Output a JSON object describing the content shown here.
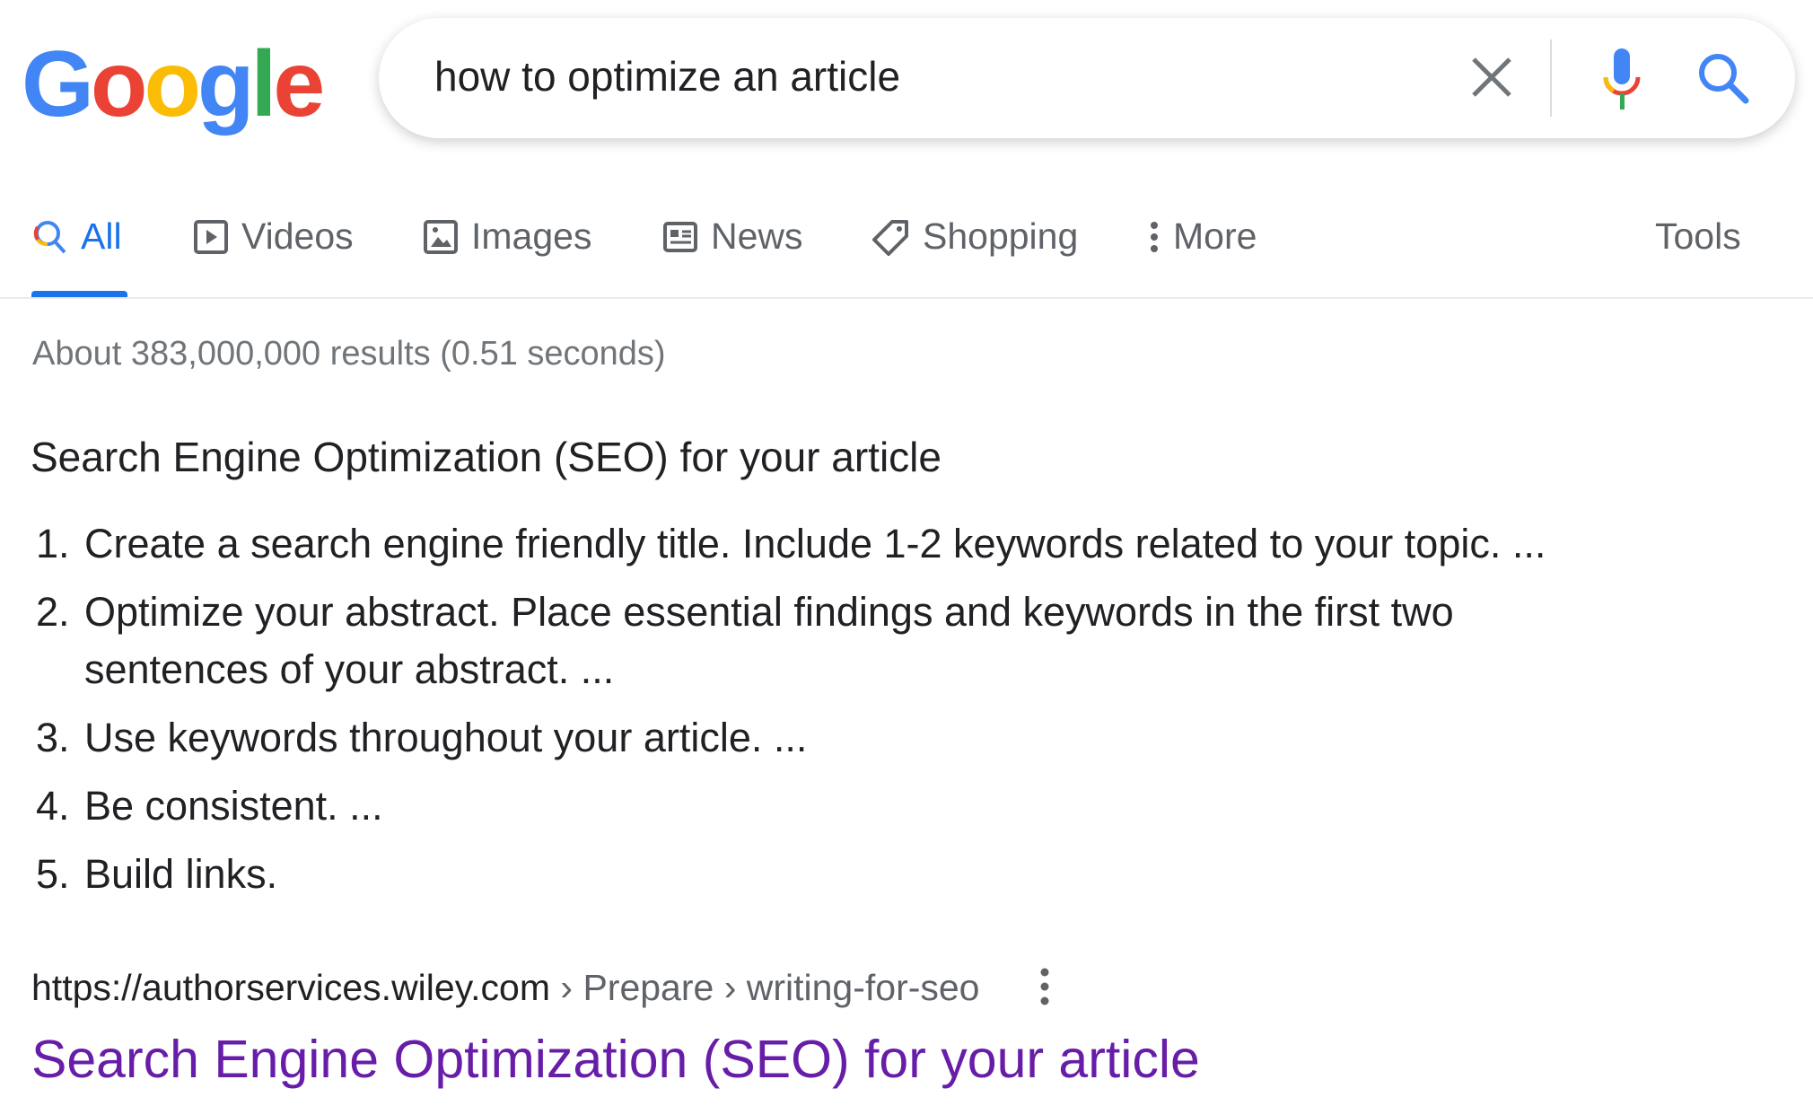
{
  "logo": {
    "text": "Google",
    "letters": [
      "G",
      "o",
      "o",
      "g",
      "l",
      "e"
    ],
    "colors": [
      "#4285f4",
      "#ea4335",
      "#fbbc05",
      "#4285f4",
      "#34a853",
      "#ea4335"
    ]
  },
  "search": {
    "query": "how to optimize an article",
    "icons": [
      "close-icon",
      "microphone-icon",
      "search-icon"
    ]
  },
  "tabs": [
    {
      "label": "All",
      "icon": "search-icon",
      "active": true
    },
    {
      "label": "Videos",
      "icon": "play-icon"
    },
    {
      "label": "Images",
      "icon": "image-icon"
    },
    {
      "label": "News",
      "icon": "newspaper-icon"
    },
    {
      "label": "Shopping",
      "icon": "tag-icon"
    },
    {
      "label": "More",
      "icon": "more-vertical-icon"
    }
  ],
  "tools_label": "Tools",
  "stats": "About 383,000,000 results (0.51 seconds)",
  "snippet": {
    "heading": "Search Engine Optimization (SEO) for your article",
    "items": [
      {
        "num": "1.",
        "lines": [
          "Create a search engine friendly title. Include 1-2 keywords related to your topic. ..."
        ]
      },
      {
        "num": "2.",
        "lines": [
          "Optimize your abstract. Place essential findings and keywords in the first two",
          "sentences of your abstract. ..."
        ]
      },
      {
        "num": "3.",
        "lines": [
          "Use keywords throughout your article. ..."
        ]
      },
      {
        "num": "4.",
        "lines": [
          "Be consistent. ..."
        ]
      },
      {
        "num": "5.",
        "lines": [
          "Build links."
        ]
      }
    ]
  },
  "result": {
    "host": "https://authorservices.wiley.com",
    "path": " › Prepare › writing-for-seo",
    "title": "Search Engine Optimization (SEO) for your article",
    "title_color": "#681da8"
  },
  "colors": {
    "accent": "#1a73e8",
    "muted": "#70757a"
  }
}
